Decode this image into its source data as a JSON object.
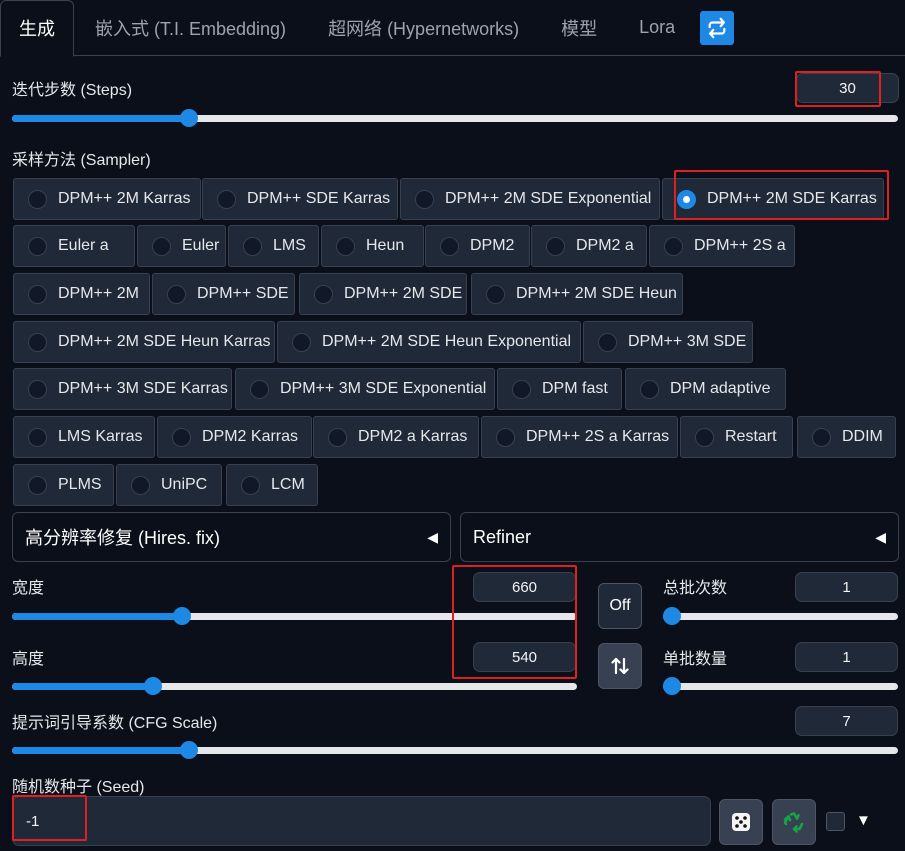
{
  "tabs": [
    {
      "label": "生成"
    },
    {
      "label": "嵌入式 (T.I. Embedding)"
    },
    {
      "label": "超网络 (Hypernetworks)"
    },
    {
      "label": "模型"
    },
    {
      "label": "Lora"
    }
  ],
  "steps": {
    "label": "迭代步数 (Steps)",
    "value": "30",
    "level": 0.2
  },
  "sampler": {
    "label": "采样方法 (Sampler)",
    "selected": "DPM++ 2M SDE Karras",
    "options": [
      "DPM++ 2M Karras",
      "DPM++ SDE Karras",
      "DPM++ 2M SDE Exponential",
      "DPM++ 2M SDE Karras",
      "Euler a",
      "Euler",
      "LMS",
      "Heun",
      "DPM2",
      "DPM2 a",
      "DPM++ 2S a",
      "DPM++ 2M",
      "DPM++ SDE",
      "DPM++ 2M SDE",
      "DPM++ 2M SDE Heun",
      "DPM++ 2M SDE Heun Karras",
      "DPM++ 2M SDE Heun Exponential",
      "DPM++ 3M SDE",
      "DPM++ 3M SDE Karras",
      "DPM++ 3M SDE Exponential",
      "DPM fast",
      "DPM adaptive",
      "LMS Karras",
      "DPM2 Karras",
      "DPM2 a Karras",
      "DPM++ 2S a Karras",
      "Restart",
      "DDIM",
      "PLMS",
      "UniPC",
      "LCM"
    ]
  },
  "hires": {
    "label": "高分辨率修复 (Hires. fix)"
  },
  "refiner": {
    "label": "Refiner"
  },
  "width": {
    "label": "宽度",
    "value": "660",
    "level": 0.3
  },
  "height": {
    "label": "高度",
    "value": "540",
    "level": 0.25
  },
  "off_label": "Off",
  "swap_icon": "swap-vertical-icon",
  "batch_count": {
    "label": "总批次数",
    "value": "1",
    "level": 0.0
  },
  "batch_size": {
    "label": "单批数量",
    "value": "1",
    "level": 0.0
  },
  "cfg": {
    "label": "提示词引导系数 (CFG Scale)",
    "value": "7",
    "level": 0.2
  },
  "seed": {
    "label": "随机数种子 (Seed)",
    "value": "-1"
  },
  "colors": {
    "accent": "#1e88e5",
    "highlight": "#e02020",
    "recycle": "#16a34a"
  }
}
